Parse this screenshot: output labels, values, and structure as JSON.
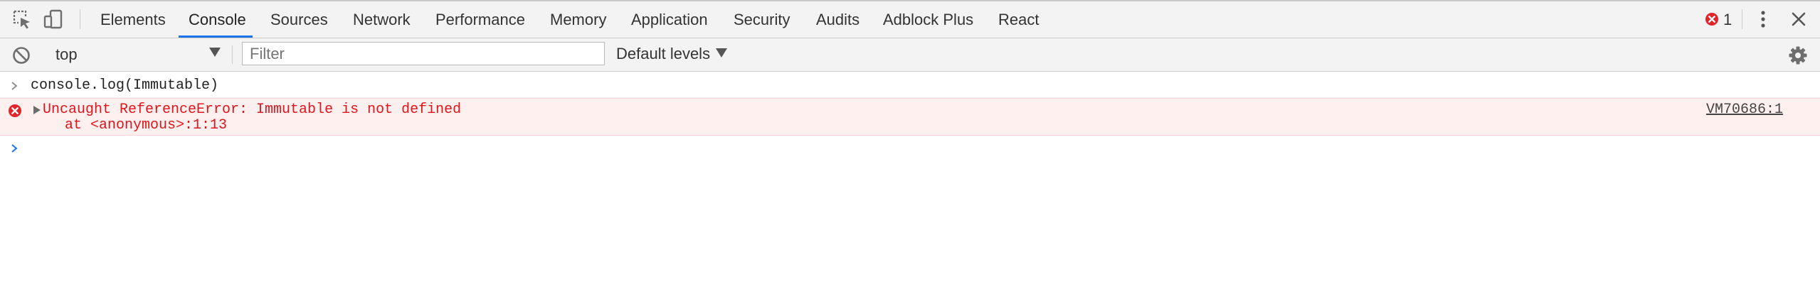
{
  "tabs": {
    "items": [
      {
        "label": "Elements"
      },
      {
        "label": "Console"
      },
      {
        "label": "Sources"
      },
      {
        "label": "Network"
      },
      {
        "label": "Performance"
      },
      {
        "label": "Memory"
      },
      {
        "label": "Application"
      },
      {
        "label": "Security"
      },
      {
        "label": "Audits"
      },
      {
        "label": "Adblock Plus"
      },
      {
        "label": "React"
      }
    ],
    "active": "Console",
    "error_count": "1"
  },
  "toolbar": {
    "context": "top",
    "filter_placeholder": "Filter",
    "levels": "Default levels"
  },
  "console": {
    "input_command": "console.log(Immutable)",
    "error_message": "Uncaught ReferenceError: Immutable is not defined",
    "error_stack": "at <anonymous>:1:13",
    "error_source": "VM70686:1"
  },
  "colors": {
    "accent": "#1a73e8",
    "error_text": "#e0151b",
    "error_bg": "#fff0f0",
    "prompt": "#1a73e8"
  },
  "icons": [
    "inspect-icon",
    "device-toolbar-icon",
    "error-icon",
    "kebab-menu-icon",
    "close-icon",
    "clear-console-icon",
    "gear-icon",
    "expand-triangle-icon"
  ]
}
